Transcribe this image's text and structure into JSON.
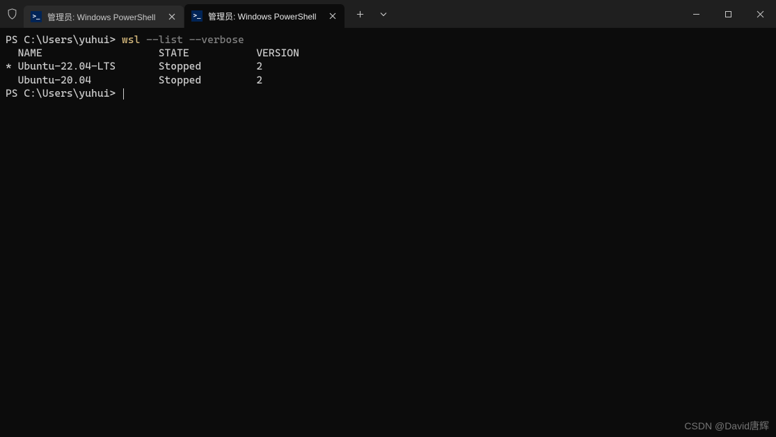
{
  "tabs": [
    {
      "title": "管理员: Windows PowerShell",
      "active": false
    },
    {
      "title": "管理员: Windows PowerShell",
      "active": true
    }
  ],
  "terminal": {
    "prompt": "PS C:\\Users\\yuhui>",
    "command": "wsl",
    "args": "--list --verbose",
    "header": {
      "indent": "  ",
      "name": "NAME",
      "state": "STATE",
      "version": "VERSION"
    },
    "rows": [
      {
        "marker": "*",
        "name": "Ubuntu-22.04-LTS",
        "state": "Stopped",
        "version": "2"
      },
      {
        "marker": " ",
        "name": "Ubuntu-20.04",
        "state": "Stopped",
        "version": "2"
      }
    ],
    "prompt2": "PS C:\\Users\\yuhui>"
  },
  "watermark": "CSDN @David唐辉"
}
